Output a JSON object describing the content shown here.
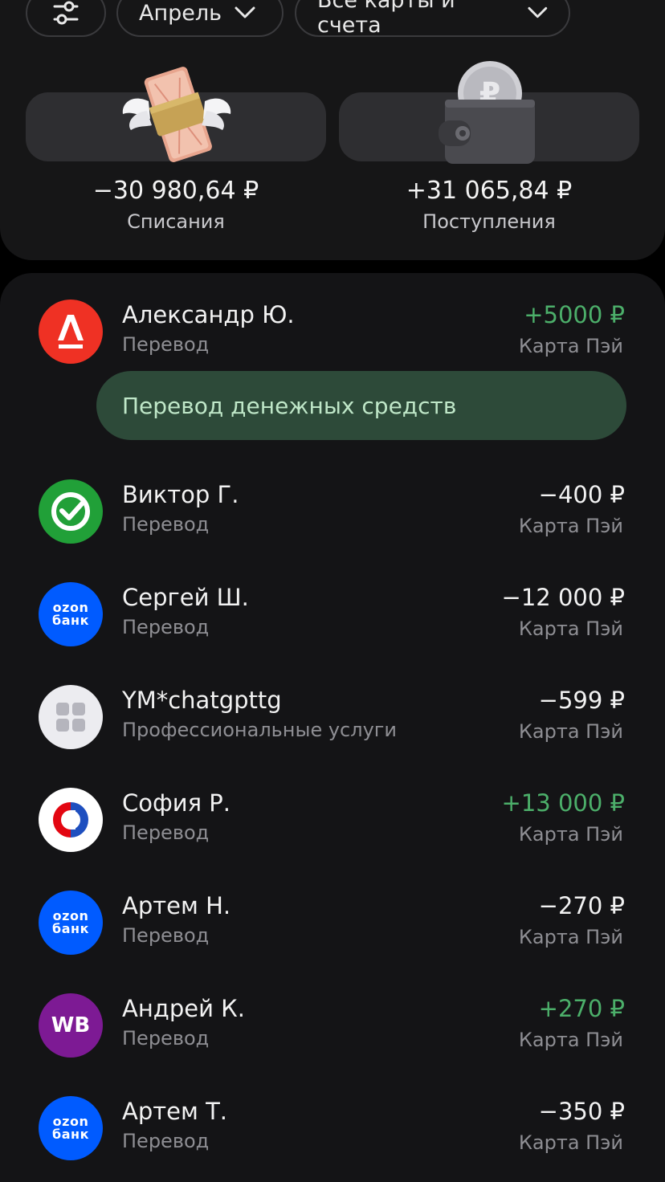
{
  "filters": {
    "filter_icon": "sliders-icon",
    "month_label": "Апрель",
    "accounts_label": "Все карты и счета"
  },
  "summary": {
    "expenses_amount": "−30 980,64 ₽",
    "expenses_label": "Списания",
    "income_amount": "+31 065,84 ₽",
    "income_label": "Поступления"
  },
  "hint": "Перевод денежных средств",
  "transactions": [
    {
      "title": "Александр Ю.",
      "subtitle": "Перевод",
      "amount": "+5000 ₽",
      "card": "Карта Пэй",
      "bank": "alfa-bank",
      "direction": "in"
    },
    {
      "title": "Виктор Г.",
      "subtitle": "Перевод",
      "amount": "−400 ₽",
      "card": "Карта Пэй",
      "bank": "sber",
      "direction": "out"
    },
    {
      "title": "Сергей Ш.",
      "subtitle": "Перевод",
      "amount": "−12 000 ₽",
      "card": "Карта Пэй",
      "bank": "ozon-bank",
      "direction": "out"
    },
    {
      "title": "YM*chatgpttg",
      "subtitle": "Профессиональные услуги",
      "amount": "−599 ₽",
      "card": "Карта Пэй",
      "bank": "category-grid",
      "direction": "out"
    },
    {
      "title": "София Р.",
      "subtitle": "Перевод",
      "amount": "+13 000 ₽",
      "card": "Карта Пэй",
      "bank": "mts-bank",
      "direction": "in"
    },
    {
      "title": "Артем Н.",
      "subtitle": "Перевод",
      "amount": "−270 ₽",
      "card": "Карта Пэй",
      "bank": "ozon-bank",
      "direction": "out"
    },
    {
      "title": "Андрей К.",
      "subtitle": "Перевод",
      "amount": "+270 ₽",
      "card": "Карта Пэй",
      "bank": "wildberries",
      "direction": "in"
    },
    {
      "title": "Артем Т.",
      "subtitle": "Перевод",
      "amount": "−350 ₽",
      "card": "Карта Пэй",
      "bank": "ozon-bank",
      "direction": "out"
    }
  ],
  "logos": {
    "ozon_line1": "ozon",
    "ozon_line2": "банк",
    "wb": "WB"
  },
  "colors": {
    "positive": "#4caf6a",
    "hint_bg": "#2d4a39",
    "alfa": "#ef3124",
    "sber": "#21a038",
    "ozon": "#005bff",
    "wb": "#7d1a94",
    "mts": "#e30611"
  }
}
